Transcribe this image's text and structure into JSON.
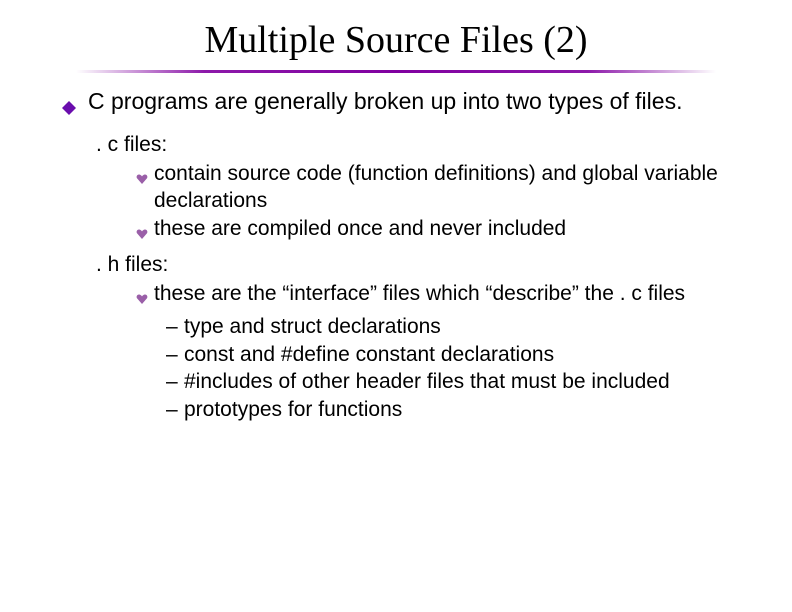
{
  "title": "Multiple Source Files (2)",
  "main_bullet": "C programs are generally broken up into two types of files.",
  "c_files_label": ". c files:",
  "c_files_points": [
    "contain source code (function definitions) and global variable declarations",
    "these are compiled once and never included"
  ],
  "h_files_label": ". h files:",
  "h_files_points": [
    "these are the “interface” files which “describe” the . c files"
  ],
  "h_files_sub": [
    "type and struct declarations",
    "const and #define constant declarations",
    "#includes of other header files that must be included",
    "prototypes for functions"
  ],
  "colors": {
    "diamond_bullet": "#6a0dad",
    "heart_bullet": "#9a5fa8"
  }
}
